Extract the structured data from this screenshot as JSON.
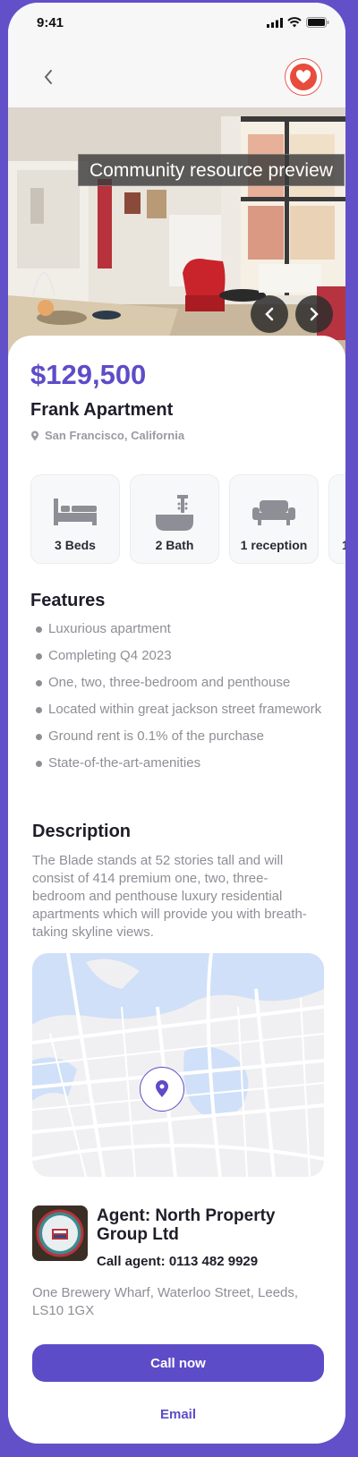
{
  "status_bar": {
    "time": "9:41"
  },
  "listing": {
    "price": "$129,500",
    "title": "Frank Apartment",
    "location": "San Francisco, California",
    "photo_tooltip": "Community resource preview"
  },
  "amenities": [
    {
      "label": "3 Beds",
      "icon": "bed-icon"
    },
    {
      "label": "2 Bath",
      "icon": "bathtub-icon"
    },
    {
      "label": "1 reception",
      "icon": "sofa-icon"
    },
    {
      "label": "1",
      "icon": "unknown-icon"
    }
  ],
  "features": {
    "heading": "Features",
    "items": [
      "Luxurious apartment",
      "Completing Q4 2023",
      "One, two, three-bedroom and penthouse",
      "Located within great jackson street framework",
      "Ground rent is 0.1% of the purchase",
      "State-of-the-art-amenities"
    ]
  },
  "description": {
    "heading": "Description",
    "text": "The Blade stands at 52 stories tall and will consist of 414 premium one, two, three-bedroom and penthouse luxury residential apartments which will provide you with breath-taking skyline views."
  },
  "agent": {
    "name": "Agent: North Property Group Ltd",
    "phone": "Call agent: 0113 482 9929",
    "address": "One Brewery Wharf, Waterloo Street, Leeds, LS10 1GX"
  },
  "actions": {
    "call": "Call now",
    "email": "Email"
  },
  "colors": {
    "accent": "#5d4cc8",
    "favorite": "#e84c3d",
    "background": "#6150c8"
  }
}
